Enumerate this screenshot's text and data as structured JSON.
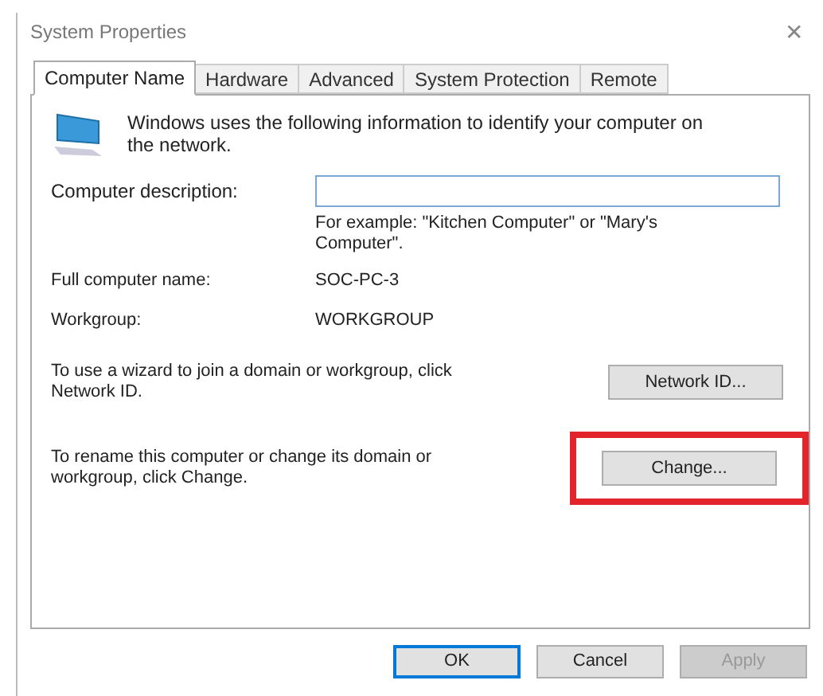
{
  "window": {
    "title": "System Properties",
    "close": "✕"
  },
  "tabs": [
    {
      "label": "Computer Name",
      "selected": true
    },
    {
      "label": "Hardware",
      "selected": false
    },
    {
      "label": "Advanced",
      "selected": false
    },
    {
      "label": "System Protection",
      "selected": false
    },
    {
      "label": "Remote",
      "selected": false
    }
  ],
  "intro": "Windows uses the following information to identify your computer on the network.",
  "description": {
    "label": "Computer description:",
    "hint": "For example: \"Kitchen Computer\" or \"Mary's Computer\"."
  },
  "info": [
    {
      "label": "Full computer name:",
      "value": "SOC-PC-3"
    },
    {
      "label": "Workgroup:",
      "value": "WORKGROUP"
    }
  ],
  "actions": [
    {
      "text": "To use a wizard to join a domain or workgroup, click Network ID.",
      "button": "Network ID...",
      "highlighted": false
    },
    {
      "text": "To rename this computer or change its domain or workgroup, click Change.",
      "button": "Change...",
      "highlighted": true
    }
  ],
  "buttons": [
    {
      "label": "OK",
      "default": true,
      "disabled": false
    },
    {
      "label": "Cancel",
      "default": false,
      "disabled": false
    },
    {
      "label": "Apply",
      "default": false,
      "disabled": true
    }
  ]
}
